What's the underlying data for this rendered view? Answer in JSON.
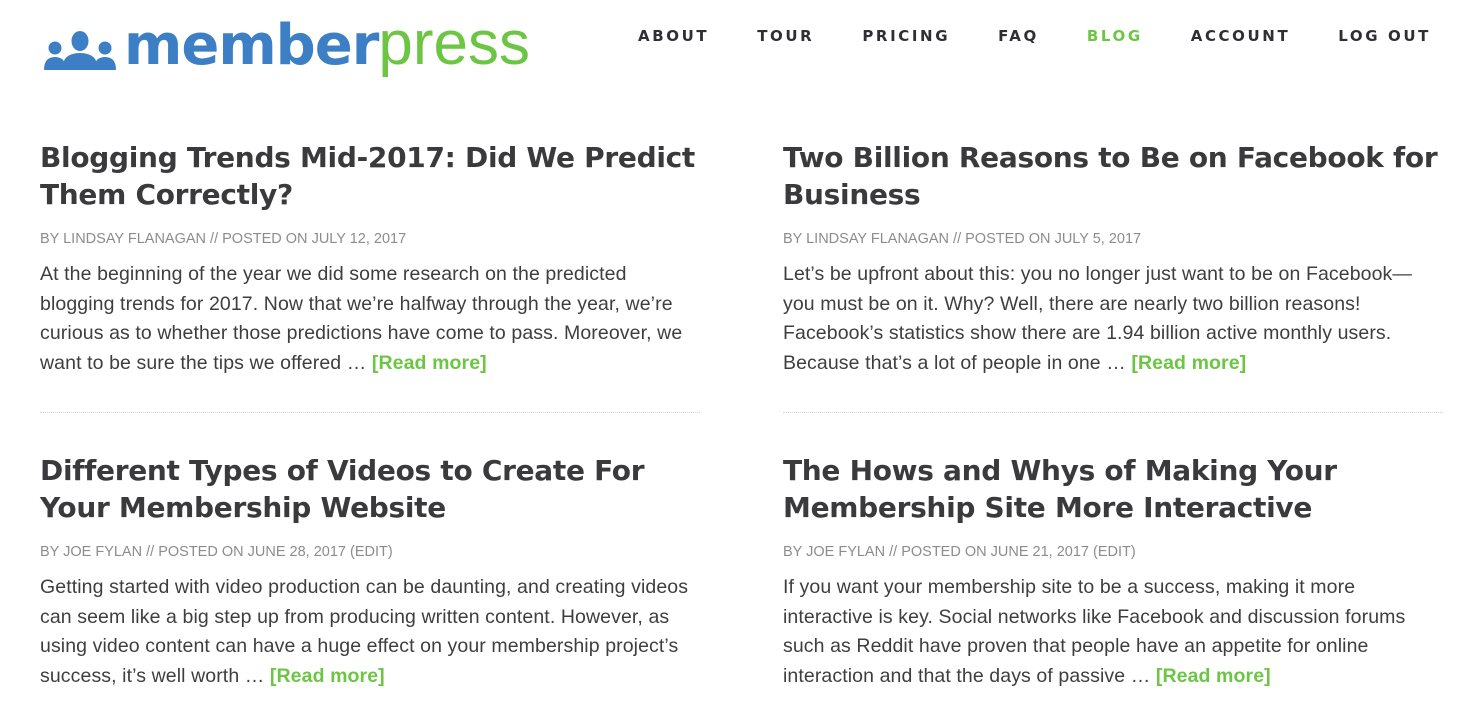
{
  "brand": {
    "name_part1": "member",
    "name_part2": "press",
    "icon": "members-group-icon",
    "colors": {
      "blue": "#3d7fc4",
      "green": "#6cc644"
    }
  },
  "nav": {
    "items": [
      {
        "label": "ABOUT",
        "active": false
      },
      {
        "label": "TOUR",
        "active": false
      },
      {
        "label": "PRICING",
        "active": false
      },
      {
        "label": "FAQ",
        "active": false
      },
      {
        "label": "BLOG",
        "active": true
      },
      {
        "label": "ACCOUNT",
        "active": false
      },
      {
        "label": "LOG OUT",
        "active": false
      }
    ]
  },
  "posts": [
    {
      "title": "Blogging Trends Mid-2017: Did We Predict Them Correctly?",
      "meta_prefix": "BY ",
      "author": "LINDSAY FLANAGAN",
      "meta_sep": " // POSTED ON ",
      "date": "JULY 12, 2017",
      "edit": "",
      "excerpt": "At the beginning of the year we did some research on the predicted blogging trends for 2017. Now that we’re halfway through the year, we’re curious as to whether those predictions have come to pass. Moreover, we want to be sure the tips we offered … ",
      "read_more": "[Read more]"
    },
    {
      "title": "Two Billion Reasons to Be on Facebook for Business",
      "meta_prefix": "BY ",
      "author": "LINDSAY FLANAGAN",
      "meta_sep": " // POSTED ON ",
      "date": "JULY 5, 2017",
      "edit": "",
      "excerpt": "Let’s be upfront about this: you no longer just want to be on Facebook—you must be on it. Why? Well, there are nearly two billion reasons! Facebook’s statistics show there are 1.94 billion active monthly users. Because that’s a lot of people in one … ",
      "read_more": "[Read more]"
    },
    {
      "title": "Different Types of Videos to Create For Your Membership Website",
      "meta_prefix": "BY ",
      "author": "JOE FYLAN",
      "meta_sep": " // POSTED ON ",
      "date": "JUNE 28, 2017",
      "edit": " (EDIT)",
      "excerpt": "Getting started with video production can be daunting, and creating videos can seem like a big step up from producing written content. However, as using video content can have a huge effect on your membership project’s success, it’s well worth … ",
      "read_more": "[Read more]"
    },
    {
      "title": "The Hows and Whys of Making Your Membership Site More Interactive",
      "meta_prefix": "BY ",
      "author": "JOE FYLAN",
      "meta_sep": " // POSTED ON ",
      "date": "JUNE 21, 2017",
      "edit": " (EDIT)",
      "excerpt": "If you want your membership site to be a success, making it more interactive is key. Social networks like Facebook and discussion forums such as Reddit have proven that people have an appetite for online interaction and that the days of passive … ",
      "read_more": "[Read more]"
    }
  ]
}
